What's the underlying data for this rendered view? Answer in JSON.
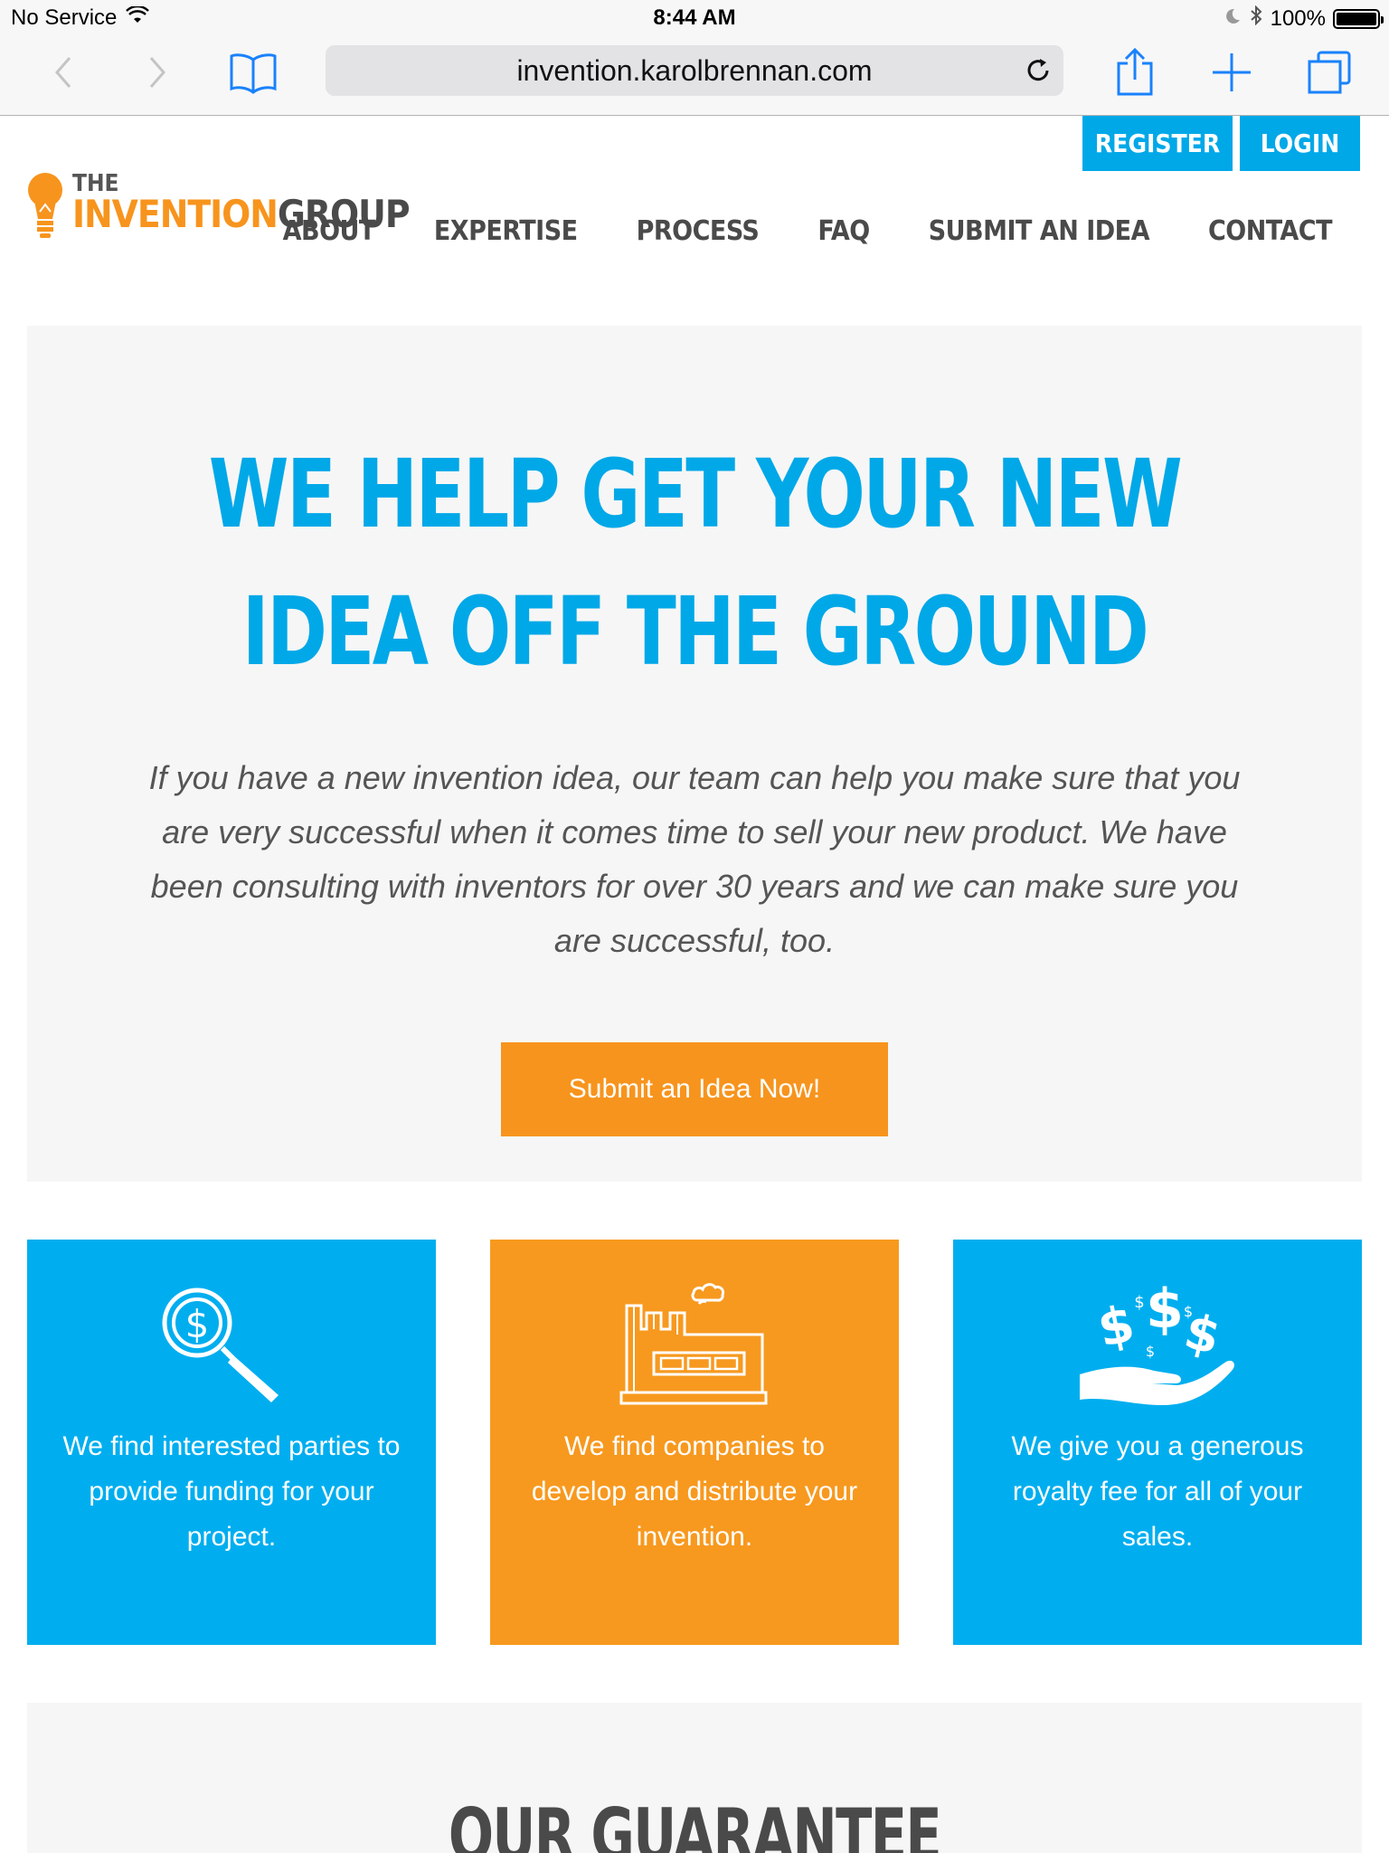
{
  "status_bar": {
    "carrier": "No Service",
    "time": "8:44 AM",
    "battery": "100%",
    "battery_level": 1.0
  },
  "browser": {
    "url": "invention.karolbrennan.com"
  },
  "header": {
    "register_label": "REGISTER",
    "login_label": "LOGIN",
    "logo": {
      "the": "THE",
      "invention": "INVENTION",
      "group": "GROUP"
    },
    "nav": [
      {
        "label": "ABOUT"
      },
      {
        "label": "EXPERTISE"
      },
      {
        "label": "PROCESS"
      },
      {
        "label": "FAQ"
      },
      {
        "label": "SUBMIT AN IDEA"
      },
      {
        "label": "CONTACT"
      }
    ]
  },
  "hero": {
    "title": "WE HELP GET YOUR NEW IDEA OFF THE GROUND",
    "text": "If you have a new invention idea, our team can help you make sure that you are very successful when it comes time to sell your new product. We have been consulting with inventors for over 30 years and we can make sure you are successful, too.",
    "button_label": "Submit an Idea Now!"
  },
  "features": [
    {
      "icon": "money-search-icon",
      "text": "We find interested parties to provide funding for your project.",
      "color": "#00aeef"
    },
    {
      "icon": "factory-icon",
      "text": "We find companies to develop and distribute your invention.",
      "color": "#f7991f"
    },
    {
      "icon": "money-hand-icon",
      "text": "We give you a generous royalty fee for all of your sales.",
      "color": "#00aeef"
    }
  ],
  "guarantee": {
    "title": "OUR GUARANTEE"
  },
  "colors": {
    "brand_blue": "#00a8e8",
    "brand_orange": "#f7941d",
    "text_gray": "#4a4a4a"
  }
}
